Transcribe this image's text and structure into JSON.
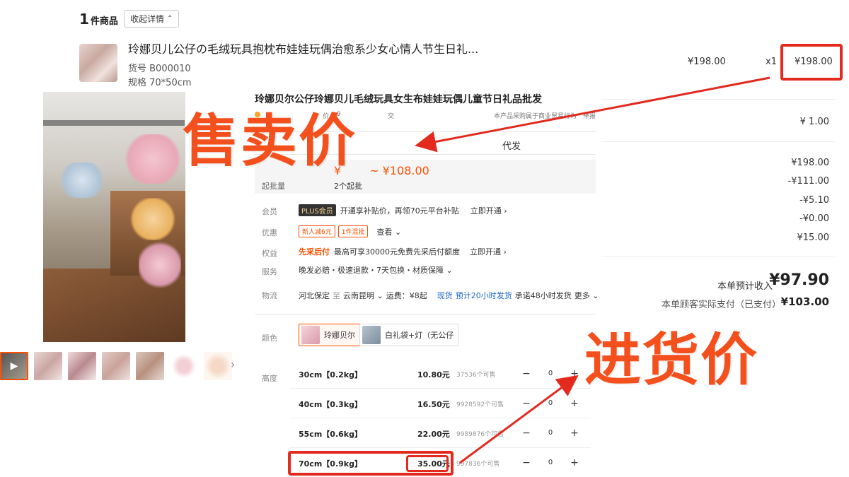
{
  "order": {
    "count_num": "1",
    "count_unit": "件商品",
    "collapse_label": "收起详情",
    "product_title": "玲娜贝儿公仔の毛绒玩具抱枕布娃娃玩偶治愈系少女心情人节生日礼...",
    "sku_line": "货号 B000010",
    "spec_line": "规格 70*50cm",
    "unit_price": "¥198.00",
    "qty": "x1",
    "total_price": "¥198.00"
  },
  "fees": {
    "shipping": "¥ 1.00",
    "subtotal": "¥198.00",
    "discount_1": "-¥111.00",
    "discount_2": "-¥5.10",
    "discount_3": "-¥0.00",
    "fee_4": "¥15.00",
    "income_label": "本单预计收入",
    "income_value": "¥97.90",
    "paid_label": "本单顾客实际支付（已支付）",
    "paid_value": "¥103.00"
  },
  "detail": {
    "title": "玲娜贝尔公仔玲娜贝儿毛绒玩具女生布娃娃玩偶儿童节日礼品批发",
    "sub_left": "价",
    "sub_mid1": "9",
    "sub_mid2": "交",
    "sub_right": "本产品采购属于商业贸易行为",
    "sub_report": "举报",
    "tab_daifa": "代发",
    "price_prefix": "¥",
    "price_range": "~ ¥108.00",
    "moq_label": "起批量",
    "moq_value": "2个起批",
    "member_label": "会员",
    "plus_tag": "PLUS会员",
    "member_text": "开通享补贴价，再领70元平台补贴",
    "member_link": "立即开通",
    "promo_label": "优惠",
    "coupon_1": "新人减6元",
    "coupon_2": "1件混批",
    "promo_link": "查看",
    "rights_label": "权益",
    "rights_tag": "先采后付",
    "rights_text": "最高可享30000元免费先采后付额度",
    "rights_link": "立即开通",
    "service_label": "服务",
    "service_text": "晚发必赔・极速退款・7天包换・材质保障",
    "logistics_label": "物流",
    "logistics_from": "河北保定",
    "logistics_to_word": "至",
    "logistics_to": "云南昆明",
    "logistics_fee": "运费：¥8起",
    "logistics_stock": "现货",
    "logistics_eta": "预计20小时发货",
    "logistics_promise": "承诺48小时发货",
    "logistics_more": "更多",
    "color_label": "颜色",
    "color_options": [
      "玲娜贝尔",
      "白礼袋+灯（无公仔"
    ],
    "size_label": "高度",
    "sizes": [
      {
        "name": "30cm【0.2kg】",
        "price": "10.80元",
        "stock": "37536个可售",
        "qty": "0"
      },
      {
        "name": "40cm【0.3kg】",
        "price": "16.50元",
        "stock": "9928592个可售",
        "qty": "0"
      },
      {
        "name": "55cm【0.6kg】",
        "price": "22.00元",
        "stock": "9989876个可售",
        "qty": "0"
      },
      {
        "name": "70cm【0.9kg】",
        "price": "35.00元",
        "stock": "997836个可售",
        "qty": "0"
      }
    ]
  },
  "annotations": {
    "sell_price_label": "售卖价",
    "cost_price_label": "进货价"
  },
  "colors": {
    "accent": "#ff5000",
    "annotation_red": "#e22a1f",
    "annotation_text": "#f4501e"
  }
}
